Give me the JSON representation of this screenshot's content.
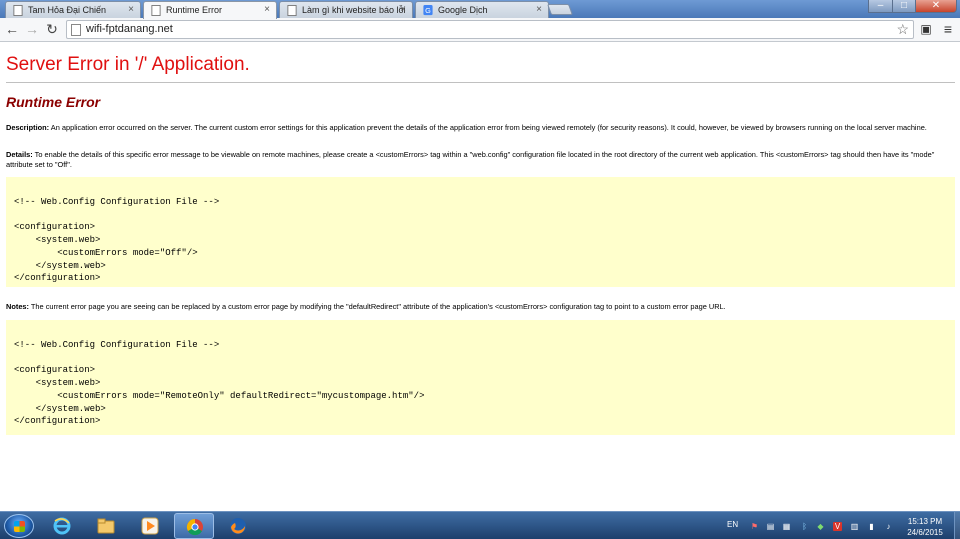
{
  "browser": {
    "tabs": [
      {
        "title": "Tam Hỏa Đại Chiến",
        "active": false
      },
      {
        "title": "Runtime Error",
        "active": true
      },
      {
        "title": "Làm gì khi website báo lỗi",
        "active": false
      },
      {
        "title": "Google Dịch",
        "active": false
      }
    ],
    "close_glyph": "×",
    "url": "wifi-fptdanang.net",
    "window_controls": {
      "minimize": "–",
      "maximize": "□",
      "close": "✕"
    }
  },
  "page": {
    "server_error_title": "Server Error in '/' Application.",
    "runtime_error_title": "Runtime Error",
    "description_label": "Description:",
    "description_text": " An application error occurred on the server. The current custom error settings for this application prevent the details of the application error from being viewed remotely (for security reasons). It could, however, be viewed by browsers running on the local server machine.",
    "details_label": "Details:",
    "details_text": " To enable the details of this specific error message to be viewable on remote machines, please create a <customErrors> tag within a \"web.config\" configuration file located in the root directory of the current web application. This <customErrors> tag should then have its \"mode\" attribute set to \"Off\".",
    "code1": "<!-- Web.Config Configuration File -->\n\n<configuration>\n    <system.web>\n        <customErrors mode=\"Off\"/>\n    </system.web>\n</configuration>",
    "notes_label": "Notes:",
    "notes_text": " The current error page you are seeing can be replaced by a custom error page by modifying the \"defaultRedirect\" attribute of the application's <customErrors> configuration tag to point to a custom error page URL.",
    "code2": "<!-- Web.Config Configuration File -->\n\n<configuration>\n    <system.web>\n        <customErrors mode=\"RemoteOnly\" defaultRedirect=\"mycustompage.htm\"/>\n    </system.web>\n</configuration>"
  },
  "taskbar": {
    "language": "EN",
    "time": "15:13 PM",
    "date": "24/6/2015"
  },
  "colors": {
    "server_error_title": "#e01010",
    "runtime_error_title": "#8b0000",
    "code_background": "#ffffcc"
  }
}
